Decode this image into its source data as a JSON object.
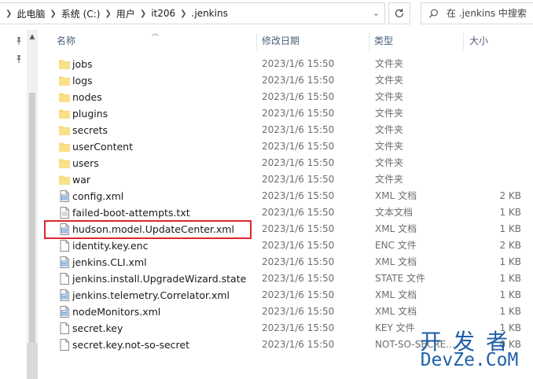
{
  "address": {
    "breadcrumbs": [
      "此电脑",
      "系统 (C:)",
      "用户",
      "it206",
      ".jenkins"
    ]
  },
  "search": {
    "placeholder": "在 .jenkins 中搜索"
  },
  "columns": {
    "name": "名称",
    "date": "修改日期",
    "type": "类型",
    "size": "大小"
  },
  "files": [
    {
      "name": "jobs",
      "date": "2023/1/6 15:50",
      "type": "文件夹",
      "size": "",
      "icon": "folder-icon"
    },
    {
      "name": "logs",
      "date": "2023/1/6 15:50",
      "type": "文件夹",
      "size": "",
      "icon": "folder-icon"
    },
    {
      "name": "nodes",
      "date": "2023/1/6 15:50",
      "type": "文件夹",
      "size": "",
      "icon": "folder-icon"
    },
    {
      "name": "plugins",
      "date": "2023/1/6 15:50",
      "type": "文件夹",
      "size": "",
      "icon": "folder-icon"
    },
    {
      "name": "secrets",
      "date": "2023/1/6 15:50",
      "type": "文件夹",
      "size": "",
      "icon": "folder-icon"
    },
    {
      "name": "userContent",
      "date": "2023/1/6 15:50",
      "type": "文件夹",
      "size": "",
      "icon": "folder-icon"
    },
    {
      "name": "users",
      "date": "2023/1/6 15:50",
      "type": "文件夹",
      "size": "",
      "icon": "folder-icon"
    },
    {
      "name": "war",
      "date": "2023/1/6 15:50",
      "type": "文件夹",
      "size": "",
      "icon": "folder-icon"
    },
    {
      "name": "config.xml",
      "date": "2023/1/6 15:50",
      "type": "XML 文档",
      "size": "2 KB",
      "icon": "xml-file-icon"
    },
    {
      "name": "failed-boot-attempts.txt",
      "date": "2023/1/6 15:50",
      "type": "文本文档",
      "size": "1 KB",
      "icon": "text-file-icon"
    },
    {
      "name": "hudson.model.UpdateCenter.xml",
      "date": "2023/1/6 15:50",
      "type": "XML 文档",
      "size": "1 KB",
      "icon": "xml-file-icon"
    },
    {
      "name": "identity.key.enc",
      "date": "2023/1/6 15:50",
      "type": "ENC 文件",
      "size": "2 KB",
      "icon": "file-icon"
    },
    {
      "name": "jenkins.CLI.xml",
      "date": "2023/1/6 15:50",
      "type": "XML 文档",
      "size": "1 KB",
      "icon": "xml-file-icon"
    },
    {
      "name": "jenkins.install.UpgradeWizard.state",
      "date": "2023/1/6 15:50",
      "type": "STATE 文件",
      "size": "1 KB",
      "icon": "file-icon"
    },
    {
      "name": "jenkins.telemetry.Correlator.xml",
      "date": "2023/1/6 15:50",
      "type": "XML 文档",
      "size": "1 KB",
      "icon": "xml-file-icon"
    },
    {
      "name": "nodeMonitors.xml",
      "date": "2023/1/6 15:50",
      "type": "XML 文档",
      "size": "1 KB",
      "icon": "xml-file-icon"
    },
    {
      "name": "secret.key",
      "date": "2023/1/6 15:50",
      "type": "KEY 文件",
      "size": "1 KB",
      "icon": "file-icon"
    },
    {
      "name": "secret.key.not-so-secret",
      "date": "2023/1/6 15:50",
      "type": "NOT-SO-SECRE...",
      "size": "0 KB",
      "icon": "file-icon"
    }
  ],
  "highlighted_file": "hudson.model.UpdateCenter.xml",
  "watermark": {
    "line1": "开发者",
    "line2": "DevZe.CoM"
  },
  "colors": {
    "folder": "#f8d775",
    "highlight_border": "#e0242e",
    "watermark": "#1f5fa8",
    "header_text": "#4c607a"
  }
}
